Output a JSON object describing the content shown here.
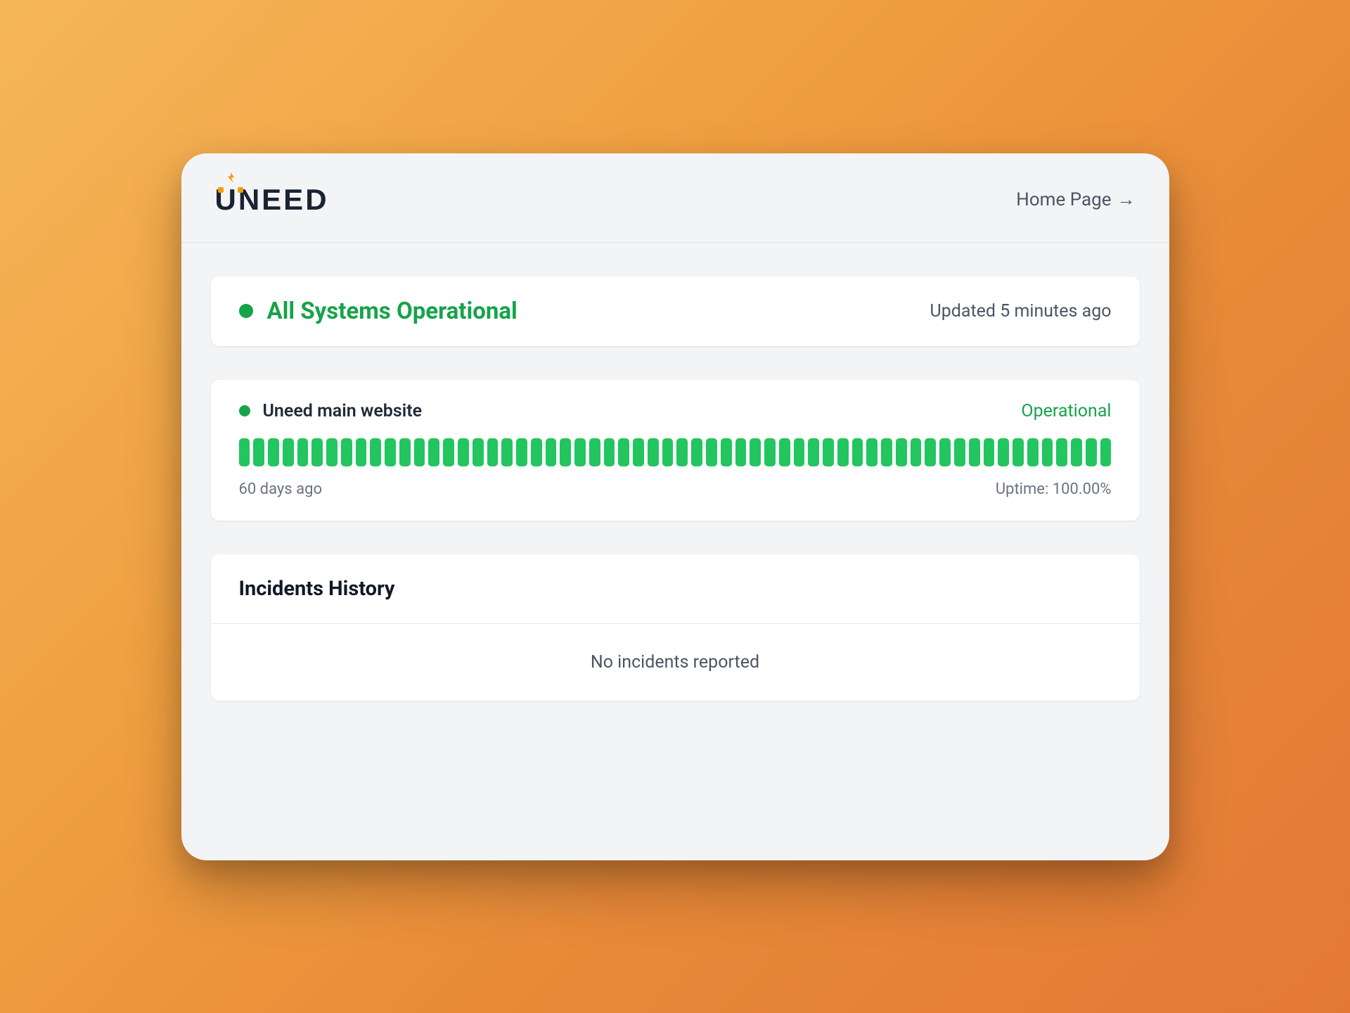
{
  "header": {
    "logo_text": "UNEED",
    "home_link": "Home Page"
  },
  "status": {
    "title": "All Systems Operational",
    "updated": "Updated 5 minutes ago"
  },
  "monitor": {
    "name": "Uneed main website",
    "status": "Operational",
    "period_label": "60 days ago",
    "uptime_label": "Uptime: 100.00%",
    "days": 60
  },
  "incidents": {
    "title": "Incidents History",
    "empty": "No incidents reported"
  },
  "colors": {
    "green": "#16a34a",
    "bar_green": "#22c55e",
    "accent_orange": "#f59e0b"
  }
}
